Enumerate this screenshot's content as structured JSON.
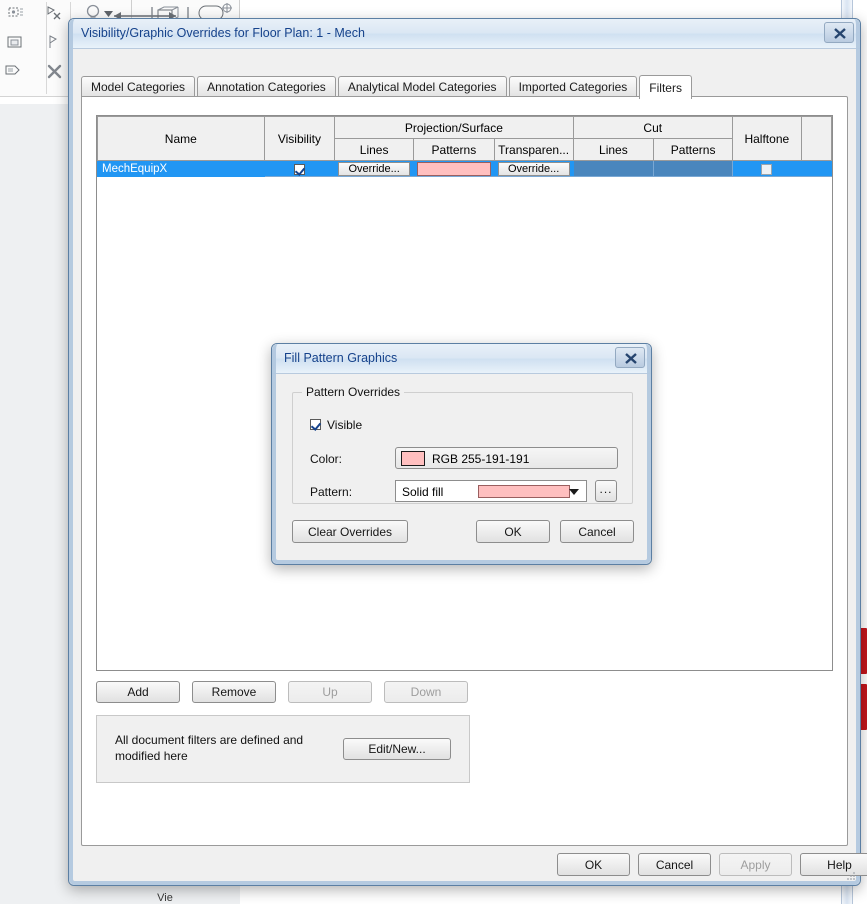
{
  "background": {
    "panel_label": "Vie",
    "icons": [
      "visibility-graphics-icon",
      "hide-element-icon",
      "light-bulb-icon",
      "dropdown-arrow-icon",
      "measure-between-icon",
      "section-box-icon",
      "render-icon",
      "crop-region-icon",
      "pin-icon",
      "paintbrush-icon",
      "tag-icon",
      "delete-x-icon",
      "align-lines-icon"
    ],
    "red_marks": 2
  },
  "main_dialog": {
    "title": "Visibility/Graphic Overrides for Floor Plan: 1 - Mech",
    "close_icon": "close-icon",
    "tabs": [
      {
        "label": "Model Categories",
        "active": false
      },
      {
        "label": "Annotation Categories",
        "active": false
      },
      {
        "label": "Analytical Model Categories",
        "active": false
      },
      {
        "label": "Imported Categories",
        "active": false
      },
      {
        "label": "Filters",
        "active": true
      }
    ],
    "grid": {
      "columns": {
        "name": "Name",
        "visibility": "Visibility",
        "projection_surface": "Projection/Surface",
        "cut": "Cut",
        "halftone": "Halftone",
        "sub_lines_projection": "Lines",
        "sub_patterns_projection": "Patterns",
        "sub_transparency": "Transparen...",
        "sub_lines_cut": "Lines",
        "sub_patterns_cut": "Patterns"
      },
      "rows": [
        {
          "name": "MechEquipX",
          "visibility_checked": true,
          "projection_lines": "Override...",
          "projection_patterns_color": "#ffbfbf",
          "transparency": "Override...",
          "cut_lines": "",
          "cut_patterns": "",
          "halftone_checked": false,
          "selected": true
        }
      ]
    },
    "actions": {
      "add": "Add",
      "remove": "Remove",
      "up": "Up",
      "down": "Down",
      "up_disabled": true,
      "down_disabled": true
    },
    "note": {
      "text": "All document filters are defined and modified here",
      "edit_new": "Edit/New..."
    },
    "footer": {
      "ok": "OK",
      "cancel": "Cancel",
      "apply": "Apply",
      "apply_disabled": true,
      "help": "Help"
    },
    "resize_grip_icon": "resize-grip-icon"
  },
  "fill_pattern_dialog": {
    "title": "Fill Pattern Graphics",
    "close_icon": "close-icon",
    "group_title": "Pattern Overrides",
    "visible_label": "Visible",
    "visible_checked": true,
    "color_label": "Color:",
    "color_value": "RGB 255-191-191",
    "color_hex": "#ffbfbf",
    "pattern_label": "Pattern:",
    "pattern_value": "Solid fill",
    "pattern_swatch_hex": "#ffbfbf",
    "browse_label": "...",
    "buttons": {
      "clear_overrides": "Clear Overrides",
      "ok": "OK",
      "cancel": "Cancel"
    }
  }
}
